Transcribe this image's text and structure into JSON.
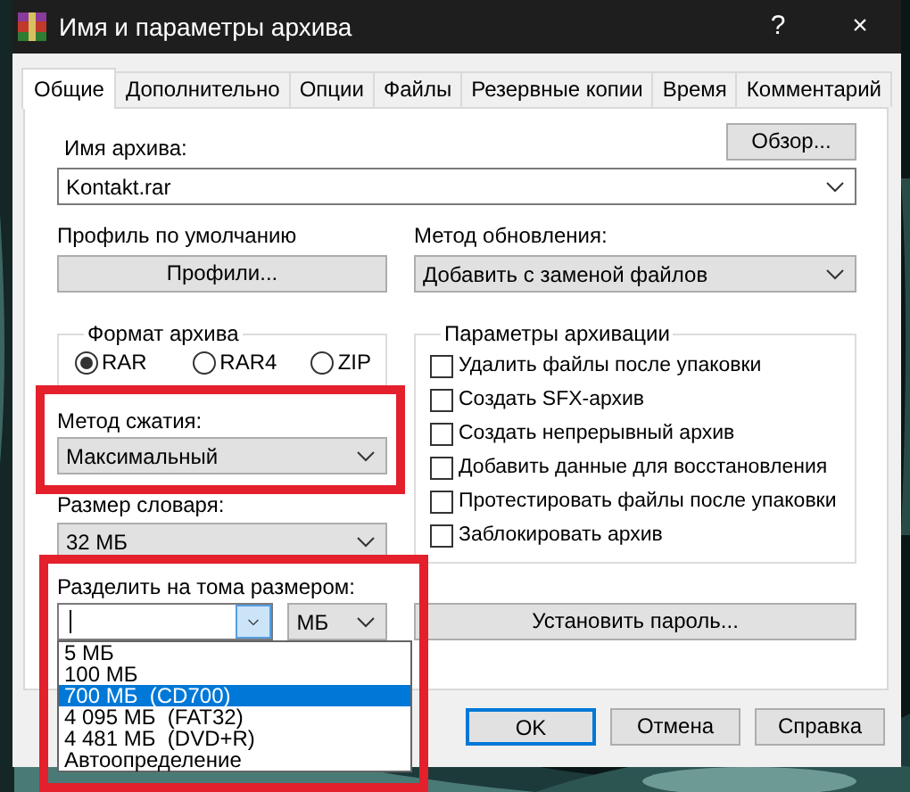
{
  "window": {
    "title": "Имя и параметры архива",
    "help_button": "?",
    "close_button": "×"
  },
  "tabs": [
    {
      "label": "Общие",
      "selected": true
    },
    {
      "label": "Дополнительно",
      "selected": false
    },
    {
      "label": "Опции",
      "selected": false
    },
    {
      "label": "Файлы",
      "selected": false
    },
    {
      "label": "Резервные копии",
      "selected": false
    },
    {
      "label": "Время",
      "selected": false
    },
    {
      "label": "Комментарий",
      "selected": false
    }
  ],
  "archive_name": {
    "label": "Имя архива:",
    "value": "Kontakt.rar",
    "browse_button": "Обзор..."
  },
  "default_profile": {
    "label": "Профиль по умолчанию",
    "button": "Профили..."
  },
  "update_method": {
    "label": "Метод обновления:",
    "value": "Добавить с заменой файлов"
  },
  "archive_format": {
    "label": "Формат архива",
    "options": [
      {
        "label": "RAR",
        "selected": true
      },
      {
        "label": "RAR4",
        "selected": false
      },
      {
        "label": "ZIP",
        "selected": false
      }
    ]
  },
  "archiving_options": {
    "label": "Параметры архивации",
    "items": [
      {
        "label": "Удалить файлы после упаковки",
        "checked": false
      },
      {
        "label": "Создать SFX-архив",
        "checked": false
      },
      {
        "label": "Создать непрерывный архив",
        "checked": false
      },
      {
        "label": "Добавить данные для восстановления",
        "checked": false
      },
      {
        "label": "Протестировать файлы после упаковки",
        "checked": false
      },
      {
        "label": "Заблокировать архив",
        "checked": false
      }
    ]
  },
  "compression_method": {
    "label": "Метод сжатия:",
    "value": "Максимальный",
    "highlighted": true
  },
  "dictionary_size": {
    "label": "Размер словаря:",
    "value": "32 МБ"
  },
  "split_volumes": {
    "label": "Разделить на тома размером:",
    "unit": "МБ",
    "highlighted": true,
    "expanded": true,
    "dropdown": [
      {
        "label": "5 МБ",
        "selected": false
      },
      {
        "label": "100 МБ",
        "selected": false
      },
      {
        "label": "700 МБ  (CD700)",
        "selected": true
      },
      {
        "label": "4 095 МБ  (FAT32)",
        "selected": false
      },
      {
        "label": "4 481 МБ  (DVD+R)",
        "selected": false
      },
      {
        "label": "Автоопределение",
        "selected": false
      }
    ]
  },
  "password_button": "Установить пароль...",
  "buttons": [
    {
      "label": "OK",
      "default": true
    },
    {
      "label": "Отмена",
      "default": false
    },
    {
      "label": "Справка",
      "default": false
    }
  ]
}
